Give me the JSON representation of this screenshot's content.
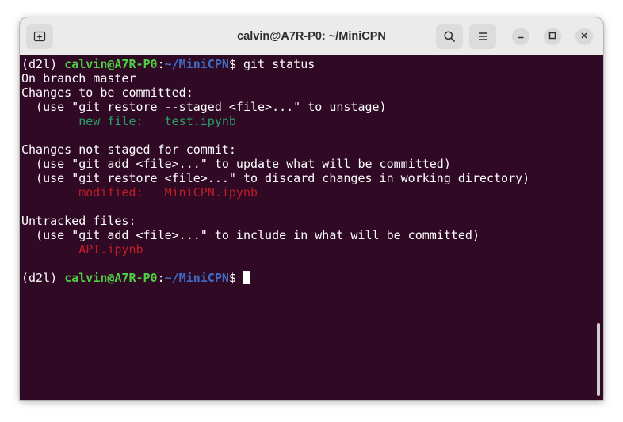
{
  "window": {
    "title": "calvin@A7R-P0: ~/MiniCPN"
  },
  "icons": {
    "new_tab": "new-tab-icon",
    "search": "search-icon",
    "menu": "hamburger-menu-icon",
    "minimize": "minimize-icon",
    "maximize": "maximize-icon",
    "close": "close-icon"
  },
  "colors": {
    "terminal_bg": "#300a24",
    "user_host": "#4ed043",
    "path": "#3f6cc7",
    "staged": "#26a269",
    "unstaged": "#c01c28"
  },
  "terminal": {
    "prompt_env": "(d2l) ",
    "prompt_user": "calvin@A7R-P0",
    "prompt_colon": ":",
    "prompt_path": "~/MiniCPN",
    "prompt_dollar": "$ ",
    "command": "git status",
    "branch_line": "On branch master",
    "staged_header": "Changes to be committed:",
    "staged_hint": "  (use \"git restore --staged <file>...\" to unstage)",
    "staged_label": "        new file:   ",
    "staged_file": "test.ipynb",
    "unstaged_header": "Changes not staged for commit:",
    "unstaged_hint1": "  (use \"git add <file>...\" to update what will be committed)",
    "unstaged_hint2": "  (use \"git restore <file>...\" to discard changes in working directory)",
    "unstaged_label": "        modified:   ",
    "unstaged_file": "MiniCPN.ipynb",
    "untracked_header": "Untracked files:",
    "untracked_hint": "  (use \"git add <file>...\" to include in what will be committed)",
    "untracked_indent": "        ",
    "untracked_file": "API.ipynb"
  }
}
